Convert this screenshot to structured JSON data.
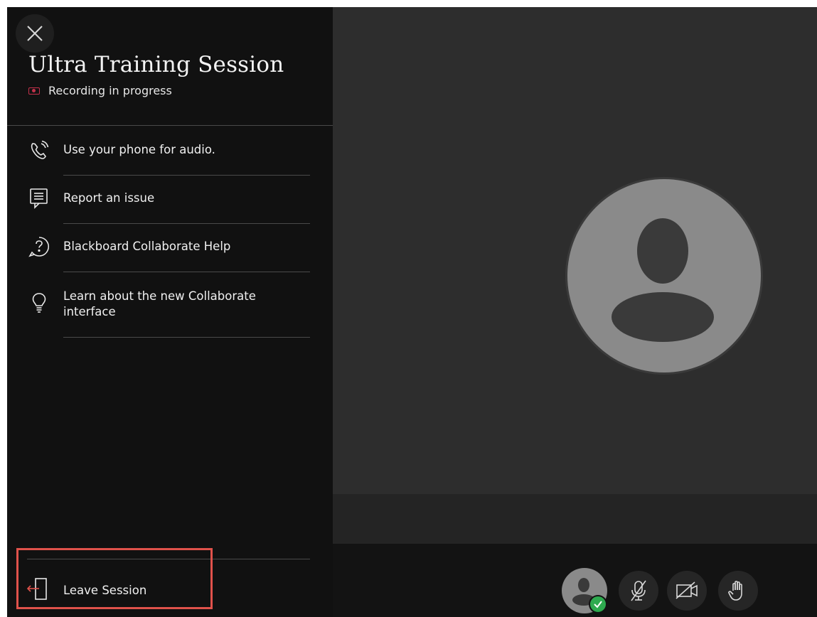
{
  "session": {
    "title": "Ultra Training Session",
    "recording_status": "Recording in progress",
    "recording_icon": "recording-icon"
  },
  "close_icon": "close-icon",
  "menu": {
    "items": [
      {
        "label": "Use your phone for audio.",
        "icon": "phone-icon"
      },
      {
        "label": "Report an issue",
        "icon": "report-issue-icon"
      },
      {
        "label": "Blackboard Collaborate Help",
        "icon": "help-icon"
      },
      {
        "label": "Learn about the new Collaborate interface",
        "icon": "lightbulb-icon"
      }
    ],
    "leave_label": "Leave Session",
    "leave_icon": "leave-session-icon"
  },
  "controls": {
    "items": [
      {
        "name": "my-status-avatar",
        "icon": "avatar-icon",
        "status": "available"
      },
      {
        "name": "microphone-toggle",
        "icon": "microphone-muted-icon",
        "state": "off"
      },
      {
        "name": "camera-toggle",
        "icon": "camera-off-icon",
        "state": "off"
      },
      {
        "name": "raise-hand-button",
        "icon": "raise-hand-icon"
      }
    ]
  },
  "colors": {
    "recording_red": "#c4314b",
    "highlight_red": "#e0524b",
    "status_green": "#2eaa4f",
    "avatar_gray": "#8a8a8a"
  }
}
